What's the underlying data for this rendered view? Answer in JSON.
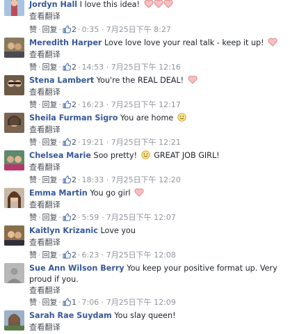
{
  "ui": {
    "reply_label": "回复",
    "like_label": "赞",
    "translate_label": "查看翻译",
    "separator": "·"
  },
  "comments": [
    {
      "author": "Jordyn Hall",
      "text": "I love this idea!",
      "likes": "",
      "time": "",
      "emoji": "hearts3"
    },
    {
      "author": "Meredith Harper",
      "text": "Love love love your real talk - keep it up!",
      "likes": "2",
      "time": "14:53 · 7月25日下午 12:16",
      "emoji": "heart"
    },
    {
      "author": "Stena Lambert",
      "text": "You're the REAL DEAL!",
      "likes": "2",
      "time": "16:23 · 7月25日下午 12:17",
      "emoji": "heart"
    },
    {
      "author": "Sheila Furman Sigro",
      "text": "You are home",
      "likes": "2",
      "time": "19:21 · 7月25日下午 12:21",
      "emoji": "smile"
    },
    {
      "author": "Chelsea Marie",
      "text": "Soo pretty!",
      "text2": "GREAT JOB GIRL!",
      "likes": "2",
      "time": "18:33 · 7月25日下午 12:20",
      "emoji": "smile-mid"
    },
    {
      "author": "Emma Martin",
      "text": "You go girl",
      "likes": "2",
      "time": "5:59 · 7月25日下午 12:07",
      "emoji": "heart"
    },
    {
      "author": "Kaitlyn Krizanic",
      "text": "Love you",
      "likes": "2",
      "time": "6:23 · 7月25日下午 12:08",
      "emoji": ""
    },
    {
      "author": "Sue Ann Wilson Berry",
      "text": "You keep your positive format up. Very proud if you.",
      "likes": "1",
      "time": "7:06 · 7月25日下午 12:09",
      "emoji": ""
    },
    {
      "author": "Sarah Rae Suydam",
      "text": "You slay queen!",
      "likes": "",
      "time": "",
      "emoji": ""
    }
  ],
  "first_actions": {
    "likes": "2",
    "time": "0:35 · 7月25日下午 8:27"
  },
  "colors": {
    "link": "#365899",
    "meta": "#90949c",
    "heart_fill": "#f7b5b5",
    "heart_stroke": "#e0787a",
    "like_blue": "#4267b2"
  }
}
